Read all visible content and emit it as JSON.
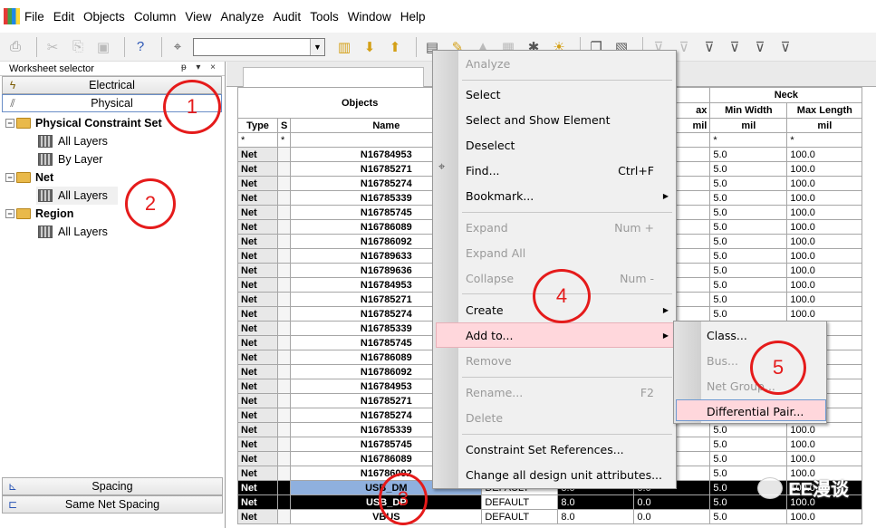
{
  "menubar": {
    "items": [
      "File",
      "Edit",
      "Objects",
      "Column",
      "View",
      "Analyze",
      "Audit",
      "Tools",
      "Window",
      "Help"
    ]
  },
  "toolbar": {
    "icons": [
      "printer-icon",
      "cut-icon",
      "copy-icon",
      "paste-icon",
      "help-icon",
      "find-net-icon",
      "combo",
      "filter-icon"
    ],
    "combo_value": ""
  },
  "left_panel": {
    "title": "Worksheet selector",
    "title_controls": "ᵽ ▾ ×",
    "tabs_top": [
      {
        "label": "Electrical",
        "icon": "lightning-icon"
      },
      {
        "label": "Physical",
        "icon": "physical-icon"
      }
    ],
    "tree": [
      {
        "level": 0,
        "label": "Physical Constraint Set",
        "toggle": "⊟"
      },
      {
        "level": 1,
        "label": "All Layers"
      },
      {
        "level": 1,
        "label": "By Layer"
      },
      {
        "level": 0,
        "label": "Net",
        "toggle": "⊟"
      },
      {
        "level": 1,
        "label": "All Layers"
      },
      {
        "level": 0,
        "label": "Region",
        "toggle": "⊟"
      },
      {
        "level": 1,
        "label": "All Layers"
      }
    ],
    "tabs_bottom": [
      {
        "label": "Spacing",
        "icon": "spacing-icon"
      },
      {
        "label": "Same Net Spacing",
        "icon": "same-net-spacing-icon"
      }
    ]
  },
  "grid": {
    "header_objects": "Objects",
    "header_neck": "Neck",
    "col_type": "Type",
    "col_s": "S",
    "col_name": "Name",
    "col_max": "ax",
    "col_min_width": "Min Width",
    "col_max_length": "Max Length",
    "unit_mil": "mil",
    "unit_mil_short": "mil",
    "filter_star": "*",
    "rows": [
      {
        "type": "Net",
        "name": "N16784953",
        "mw": "5.0",
        "ml": "100.0"
      },
      {
        "type": "Net",
        "name": "N16785271",
        "mw": "5.0",
        "ml": "100.0"
      },
      {
        "type": "Net",
        "name": "N16785274",
        "mw": "5.0",
        "ml": "100.0"
      },
      {
        "type": "Net",
        "name": "N16785339",
        "mw": "5.0",
        "ml": "100.0"
      },
      {
        "type": "Net",
        "name": "N16785745",
        "mw": "5.0",
        "ml": "100.0"
      },
      {
        "type": "Net",
        "name": "N16786089",
        "mw": "5.0",
        "ml": "100.0"
      },
      {
        "type": "Net",
        "name": "N16786092",
        "mw": "5.0",
        "ml": "100.0"
      },
      {
        "type": "Net",
        "name": "N16789633",
        "mw": "5.0",
        "ml": "100.0"
      },
      {
        "type": "Net",
        "name": "N16789636",
        "mw": "5.0",
        "ml": "100.0"
      },
      {
        "type": "Net",
        "name": "N16784953",
        "mw": "5.0",
        "ml": "100.0"
      },
      {
        "type": "Net",
        "name": "N16785271",
        "mw": "5.0",
        "ml": "100.0"
      },
      {
        "type": "Net",
        "name": "N16785274",
        "mw": "5.0",
        "ml": "100.0"
      },
      {
        "type": "Net",
        "name": "N16785339",
        "mw": "5.0",
        "ml": "100.0"
      },
      {
        "type": "Net",
        "name": "N16785745",
        "mw": "5.0",
        "ml": "100.0"
      },
      {
        "type": "Net",
        "name": "N16786089",
        "mw": "5.0",
        "ml": "100.0"
      },
      {
        "type": "Net",
        "name": "N16786092",
        "mw": "5.0",
        "ml": "100.0"
      },
      {
        "type": "Net",
        "name": "N16784953",
        "mw": "5.0",
        "ml": "100.0"
      },
      {
        "type": "Net",
        "name": "N16785271",
        "mw": "5.0",
        "ml": "100.0"
      },
      {
        "type": "Net",
        "name": "N16785274",
        "mw": "5.0",
        "ml": "100.0"
      },
      {
        "type": "Net",
        "name": "N16785339",
        "mw": "5.0",
        "ml": "100.0"
      },
      {
        "type": "Net",
        "name": "N16785745",
        "mw": "5.0",
        "ml": "100.0"
      },
      {
        "type": "Net",
        "name": "N16786089",
        "mw": "5.0",
        "ml": "100.0"
      },
      {
        "type": "Net",
        "name": "N16786092",
        "mw": "5.0",
        "ml": "100.0"
      }
    ],
    "sel_rows": [
      {
        "type": "Net",
        "name": "USB_DM",
        "cs": "DEFAULT",
        "v1": "8.0",
        "v2": "0.0",
        "mw": "5.0",
        "ml": "100.0"
      },
      {
        "type": "Net",
        "name": "USB_DP",
        "cs": "DEFAULT",
        "v1": "8.0",
        "v2": "0.0",
        "mw": "5.0",
        "ml": "100.0"
      },
      {
        "type": "Net",
        "name": "VBUS",
        "cs": "DEFAULT",
        "v1": "8.0",
        "v2": "0.0",
        "mw": "5.0",
        "ml": "100.0"
      }
    ]
  },
  "context_menu": {
    "analyze": "Analyze",
    "select": "Select",
    "select_show": "Select and Show Element",
    "deselect": "Deselect",
    "find": "Find...",
    "find_shortcut": "Ctrl+F",
    "bookmark": "Bookmark...",
    "expand": "Expand",
    "expand_shortcut": "Num +",
    "expand_all": "Expand All",
    "collapse": "Collapse",
    "collapse_shortcut": "Num -",
    "create": "Create",
    "add_to": "Add to...",
    "remove": "Remove",
    "rename": "Rename...",
    "rename_shortcut": "F2",
    "delete": "Delete",
    "cs_refs": "Constraint Set References...",
    "change_attrs": "Change all design unit attributes..."
  },
  "submenu": {
    "class": "Class...",
    "bus": "Bus...",
    "net_group": "Net Group...",
    "diff_pair": "Differential Pair..."
  },
  "annotations": [
    "1",
    "2",
    "3",
    "4",
    "5"
  ],
  "watermark": "EE漫谈",
  "colors": {
    "annotation": "#e51b1b",
    "highlight": "#ffd7dc",
    "selection": "#8fb0de"
  }
}
